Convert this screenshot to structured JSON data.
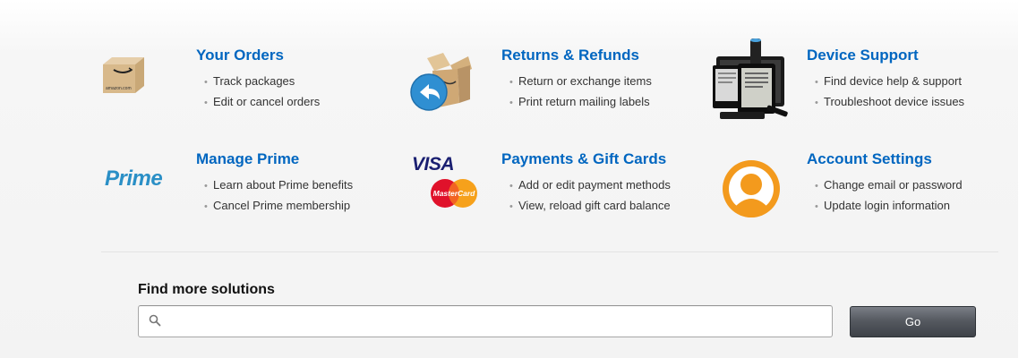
{
  "cards": [
    {
      "title": "Your Orders",
      "items": [
        "Track packages",
        "Edit or cancel orders"
      ],
      "icon": "package-box-icon",
      "icon_text": "amazon.com"
    },
    {
      "title": "Returns & Refunds",
      "items": [
        "Return or exchange items",
        "Print return mailing labels"
      ],
      "icon": "return-box-icon"
    },
    {
      "title": "Device Support",
      "items": [
        "Find device help & support",
        "Troubleshoot device issues"
      ],
      "icon": "devices-icon"
    },
    {
      "title": "Manage Prime",
      "items": [
        "Learn about Prime benefits",
        "Cancel Prime membership"
      ],
      "icon": "prime-logo-icon",
      "icon_text": "Prime"
    },
    {
      "title": "Payments & Gift Cards",
      "items": [
        "Add or edit payment methods",
        "View, reload gift card balance"
      ],
      "icon": "payment-cards-icon",
      "icon_text": "VISA",
      "icon_text2": "MasterCard"
    },
    {
      "title": "Account Settings",
      "items": [
        "Change email or password",
        "Update login information"
      ],
      "icon": "user-avatar-icon"
    }
  ],
  "find_more": {
    "label": "Find more solutions",
    "placeholder": "",
    "go_label": "Go"
  },
  "colors": {
    "link": "#0066c0",
    "prime": "#2a8fc6",
    "avatar": "#f39a1d",
    "button": "#4c5057"
  }
}
